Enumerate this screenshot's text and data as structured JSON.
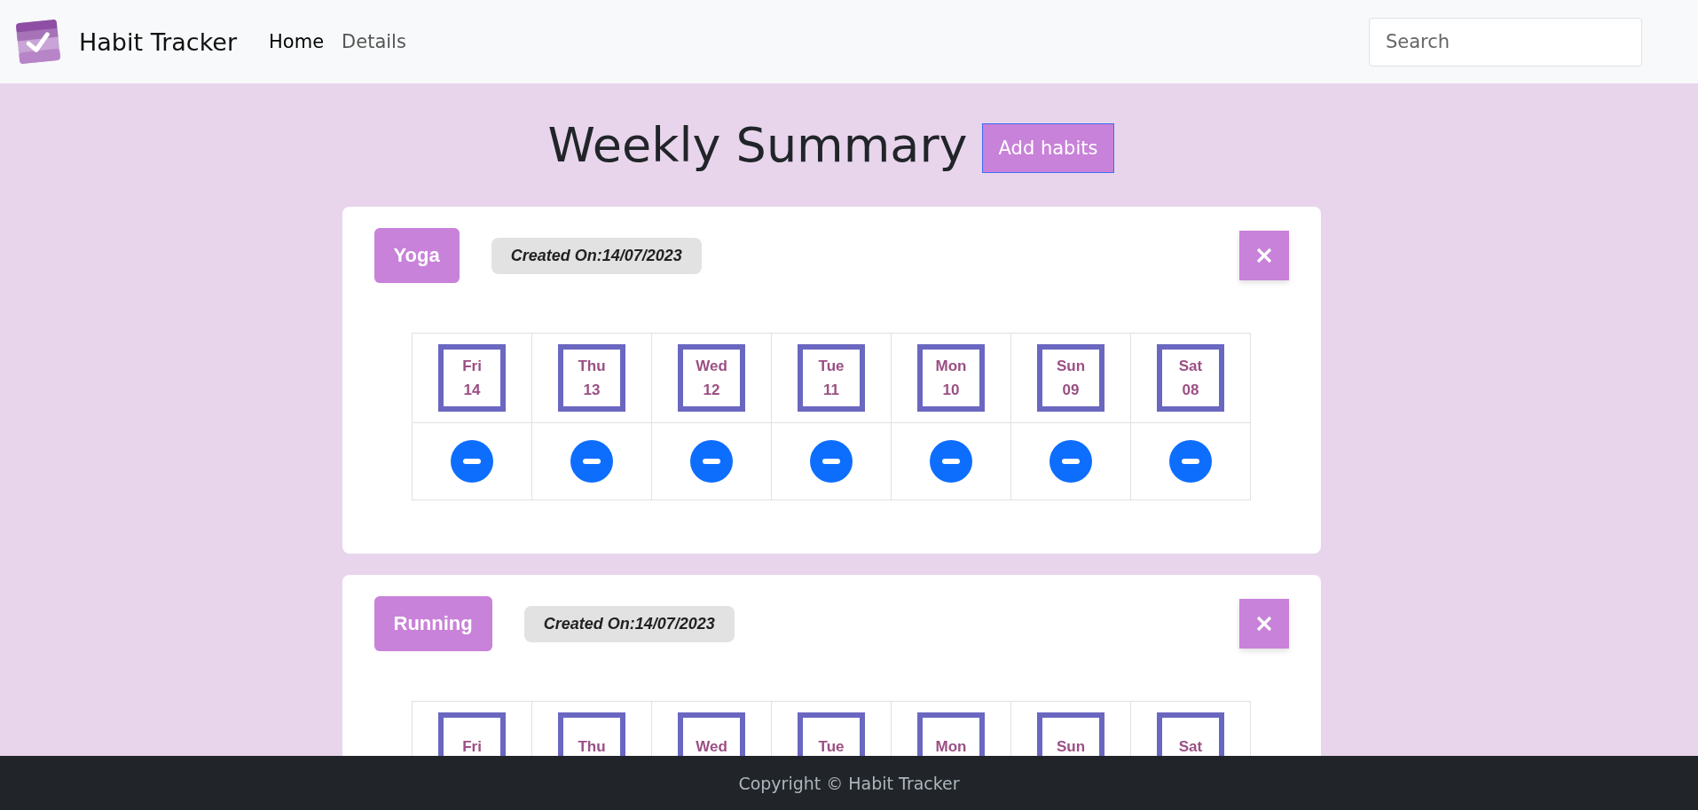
{
  "navbar": {
    "brand": "Habit Tracker",
    "links": [
      {
        "label": "Home",
        "selected": true
      },
      {
        "label": "Details",
        "selected": false
      }
    ],
    "search": {
      "placeholder": "Search"
    }
  },
  "heading": "Weekly Summary",
  "add_button": "Add habits",
  "habits": [
    {
      "name": "Yoga",
      "created": "Created On:14/07/2023",
      "days": [
        {
          "day": "Fri",
          "date": "14",
          "kind": "none"
        },
        {
          "day": "Thu",
          "date": "13",
          "kind": "none"
        },
        {
          "day": "Wed",
          "date": "12",
          "kind": "none"
        },
        {
          "day": "Tue",
          "date": "11",
          "kind": "none"
        },
        {
          "day": "Mon",
          "date": "10",
          "kind": "none"
        },
        {
          "day": "Sun",
          "date": "09",
          "kind": "none"
        },
        {
          "day": "Sat",
          "date": "08",
          "kind": "none"
        }
      ]
    },
    {
      "name": "Running",
      "created": "Created On:14/07/2023",
      "days": [
        {
          "day": "Fri"
        },
        {
          "day": "Thu"
        },
        {
          "day": "Wed"
        },
        {
          "day": "Tue"
        },
        {
          "day": "Mon"
        },
        {
          "day": "Sun"
        },
        {
          "day": "Sat"
        }
      ]
    }
  ],
  "footer": "Copyright © Habit Tracker"
}
